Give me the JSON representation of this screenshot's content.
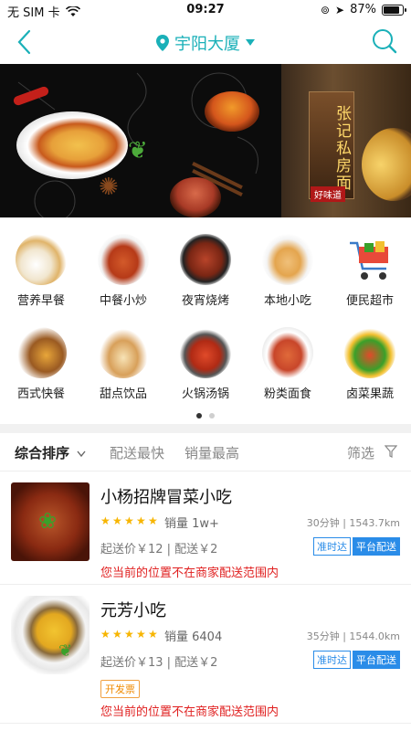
{
  "status_bar": {
    "carrier": "无 SIM 卡",
    "time": "09:27",
    "battery": "87%",
    "battery_level": 0.87
  },
  "nav": {
    "location": "宇阳大厦",
    "accent_color": "#1ab0b8"
  },
  "banner": {
    "sign_text": "张记私房面",
    "tag_text": "好味道"
  },
  "categories": [
    {
      "label": "营养早餐",
      "icon": "breakfast-icon"
    },
    {
      "label": "中餐小炒",
      "icon": "stir-fry-icon"
    },
    {
      "label": "夜宵烧烤",
      "icon": "bbq-icon"
    },
    {
      "label": "本地小吃",
      "icon": "snack-icon"
    },
    {
      "label": "便民超市",
      "icon": "shopping-cart-icon"
    },
    {
      "label": "西式快餐",
      "icon": "burger-icon"
    },
    {
      "label": "甜点饮品",
      "icon": "dessert-icon"
    },
    {
      "label": "火锅汤锅",
      "icon": "hotpot-icon"
    },
    {
      "label": "粉类面食",
      "icon": "noodle-icon"
    },
    {
      "label": "卤菜果蔬",
      "icon": "vegetable-icon"
    }
  ],
  "sort_bar": {
    "default": "综合排序",
    "delivery_fast": "配送最快",
    "sales_high": "销量最高",
    "filter": "筛选"
  },
  "shops": [
    {
      "name": "小杨招牌冒菜小吃",
      "rating": 5,
      "sales": "销量 1w+",
      "eta": "30分钟 | 1543.7km",
      "fee": "起送价￥12 | 配送￥2",
      "badge_on_time": "准时达",
      "badge_platform": "平台配送",
      "warning": "您当前的位置不在商家配送范围内"
    },
    {
      "name": "元芳小吃",
      "rating": 5,
      "sales": "销量 6404",
      "eta": "35分钟 | 1544.0km",
      "fee": "起送价￥13 | 配送￥2",
      "badge_on_time": "准时达",
      "badge_platform": "平台配送",
      "invoice": "开发票",
      "warning": "您当前的位置不在商家配送范围内"
    }
  ]
}
